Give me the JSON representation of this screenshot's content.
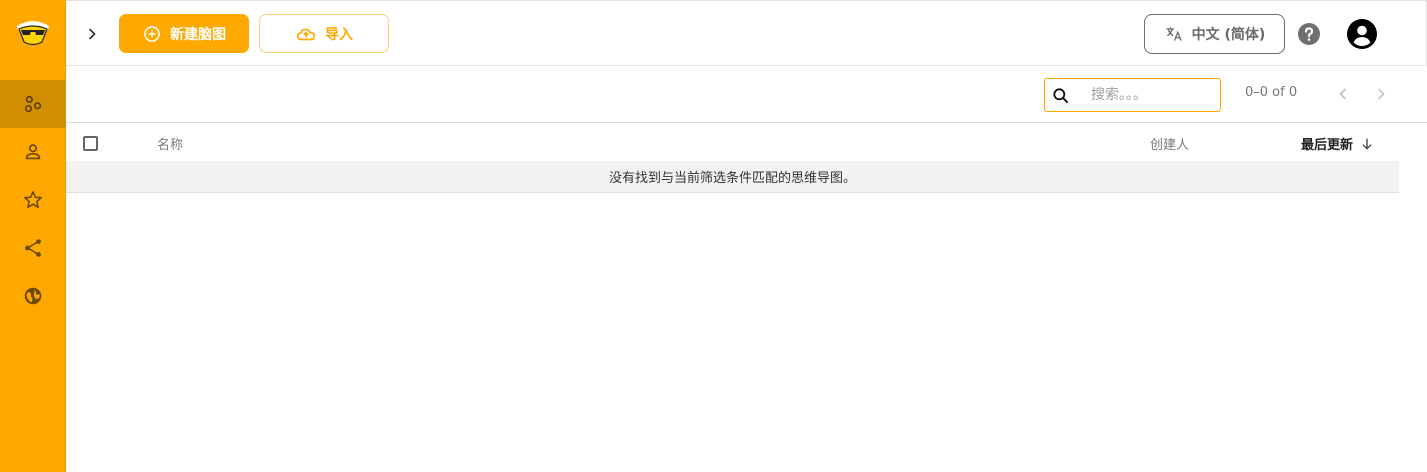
{
  "sidebar": {
    "items": [
      {
        "icon": "mindmaps-icon",
        "active": true
      },
      {
        "icon": "person-icon",
        "active": false
      },
      {
        "icon": "star-icon",
        "active": false
      },
      {
        "icon": "share-icon",
        "active": false
      },
      {
        "icon": "globe-icon",
        "active": false
      }
    ],
    "accent": "#ffa800"
  },
  "header": {
    "new_label": "新建脑图",
    "import_label": "导入",
    "language_label": "中文 (简体)"
  },
  "toolbar": {
    "search_placeholder": "搜索。。。",
    "page_range": "0–0 of 0"
  },
  "table": {
    "columns": {
      "name": "名称",
      "creator": "创建人",
      "updated": "最后更新"
    },
    "empty_message": "没有找到与当前筛选条件匹配的思维导图。"
  }
}
